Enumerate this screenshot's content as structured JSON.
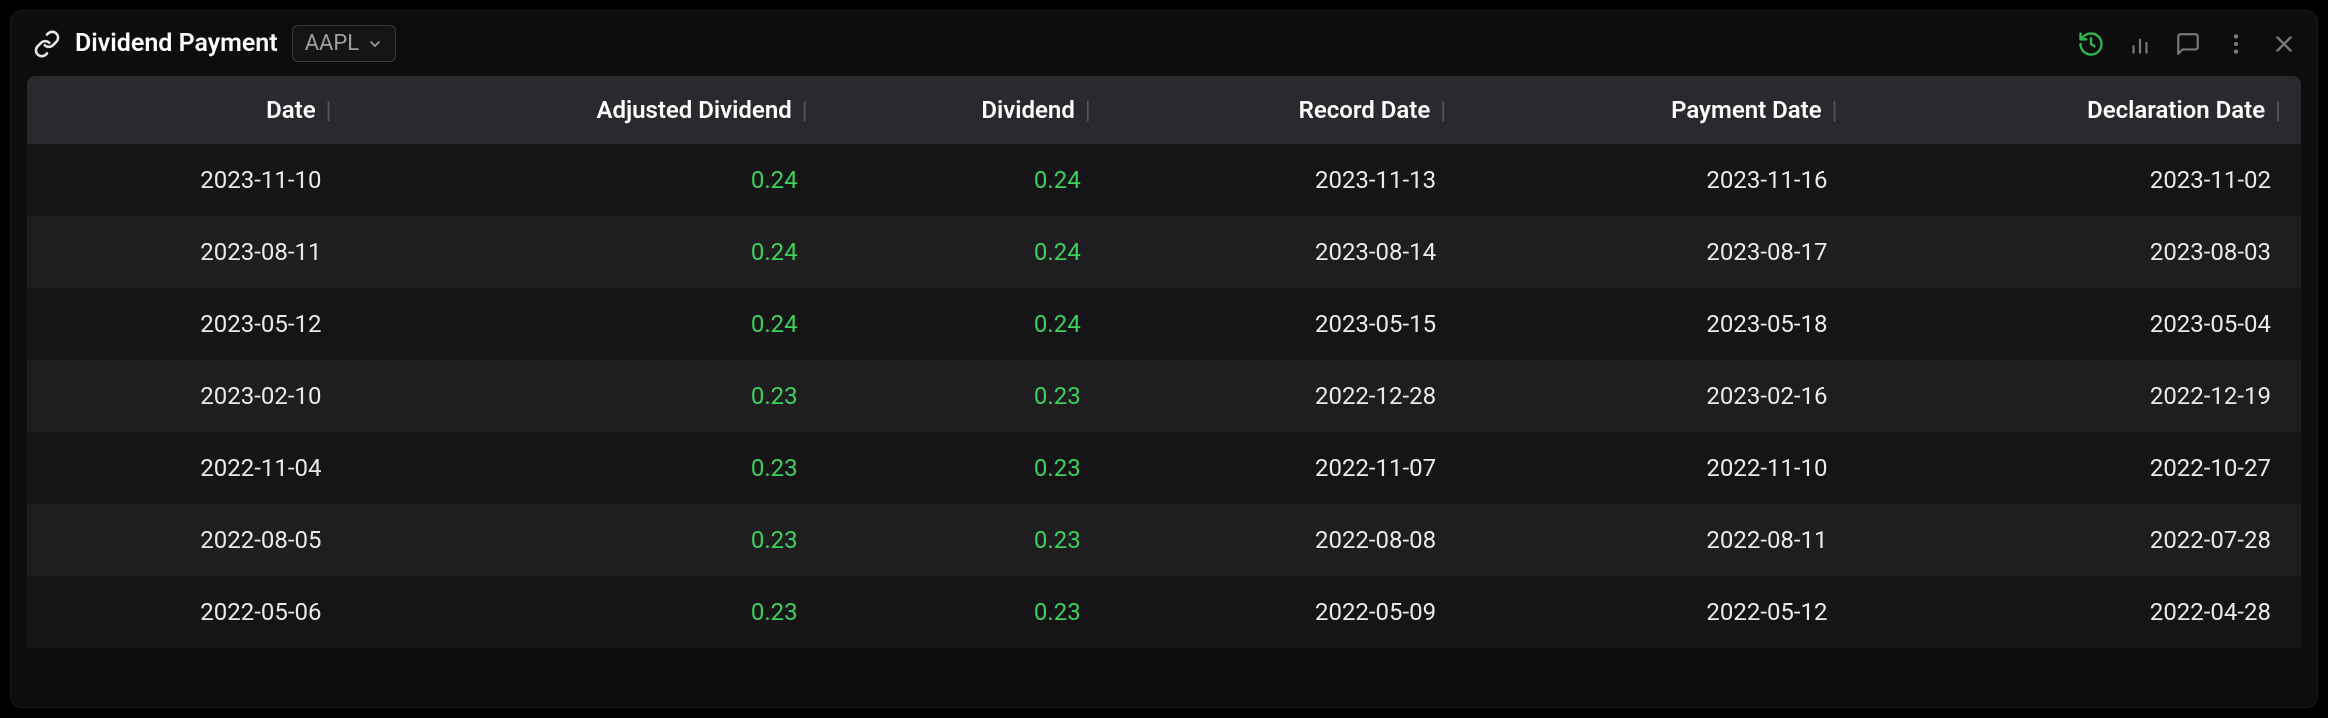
{
  "header": {
    "title": "Dividend Payment",
    "ticker": "AAPL"
  },
  "columns": [
    "Date",
    "Adjusted Dividend",
    "Dividend",
    "Record Date",
    "Payment Date",
    "Declaration Date"
  ],
  "rows": [
    {
      "date": "2023-11-10",
      "adj": "0.24",
      "div": "0.24",
      "record": "2023-11-13",
      "payment": "2023-11-16",
      "decl": "2023-11-02"
    },
    {
      "date": "2023-08-11",
      "adj": "0.24",
      "div": "0.24",
      "record": "2023-08-14",
      "payment": "2023-08-17",
      "decl": "2023-08-03"
    },
    {
      "date": "2023-05-12",
      "adj": "0.24",
      "div": "0.24",
      "record": "2023-05-15",
      "payment": "2023-05-18",
      "decl": "2023-05-04"
    },
    {
      "date": "2023-02-10",
      "adj": "0.23",
      "div": "0.23",
      "record": "2022-12-28",
      "payment": "2023-02-16",
      "decl": "2022-12-19"
    },
    {
      "date": "2022-11-04",
      "adj": "0.23",
      "div": "0.23",
      "record": "2022-11-07",
      "payment": "2022-11-10",
      "decl": "2022-10-27"
    },
    {
      "date": "2022-08-05",
      "adj": "0.23",
      "div": "0.23",
      "record": "2022-08-08",
      "payment": "2022-08-11",
      "decl": "2022-07-28"
    },
    {
      "date": "2022-05-06",
      "adj": "0.23",
      "div": "0.23",
      "record": "2022-05-09",
      "payment": "2022-05-12",
      "decl": "2022-04-28"
    }
  ]
}
